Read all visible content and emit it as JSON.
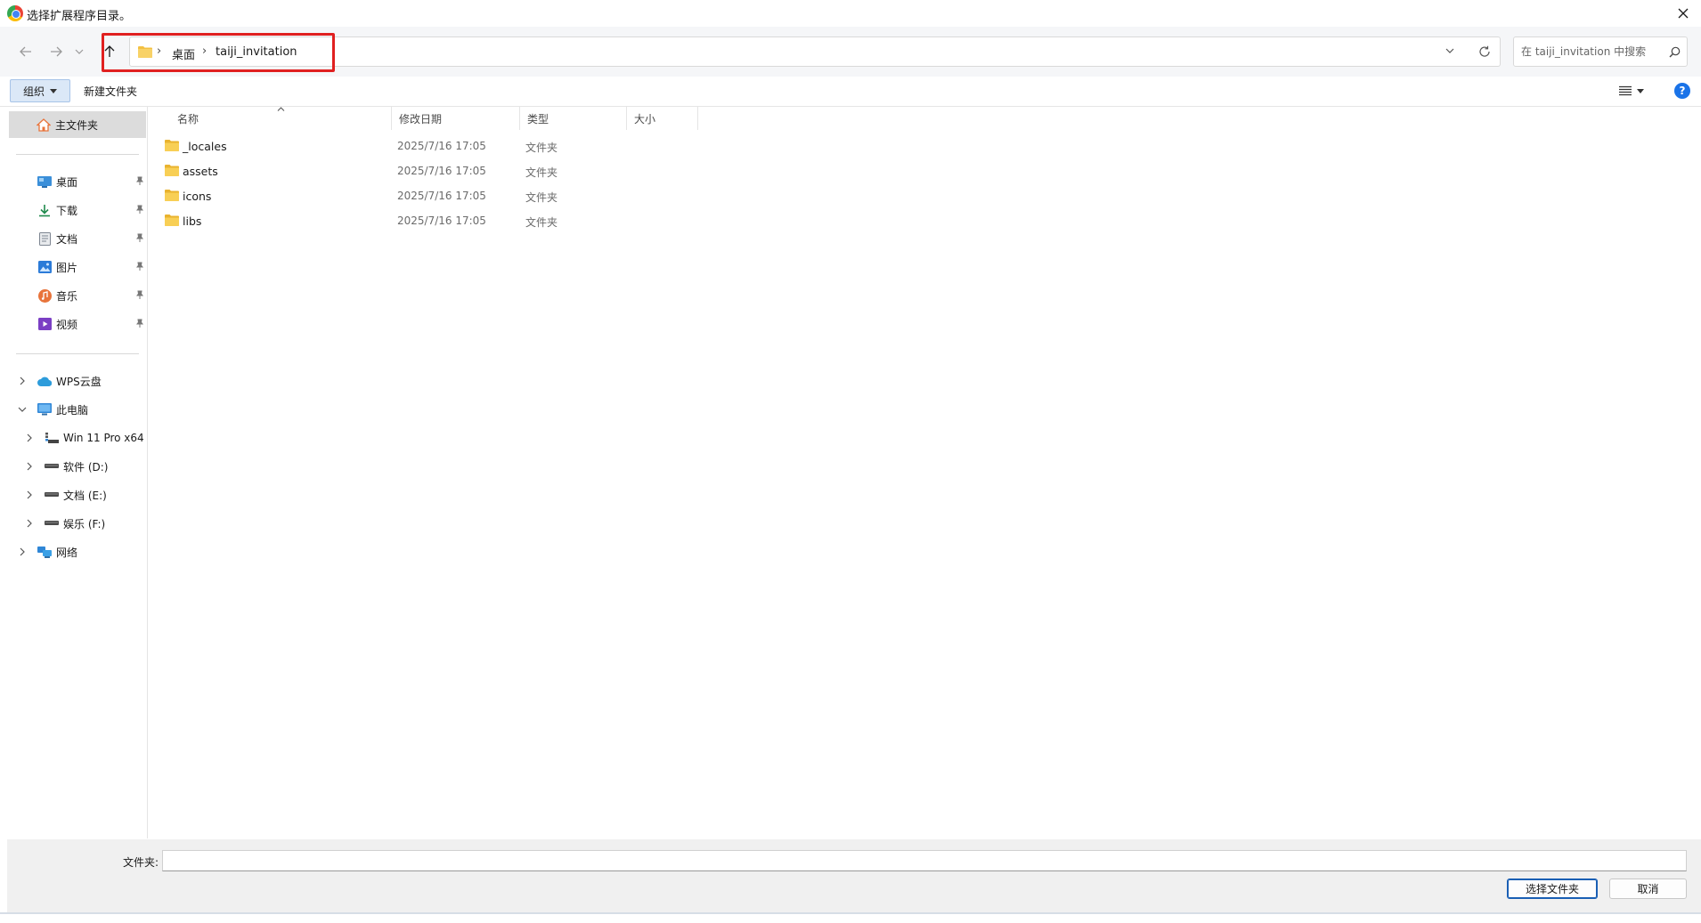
{
  "window": {
    "title": "选择扩展程序目录。"
  },
  "nav": {
    "breadcrumbs": [
      "桌面",
      "taiji_invitation"
    ],
    "search_placeholder": "在 taiji_invitation 中搜索"
  },
  "toolbar": {
    "organize_label": "组织",
    "new_folder_label": "新建文件夹",
    "help_label": "?"
  },
  "sidebar": {
    "home": "主文件夹",
    "quick_access": [
      {
        "label": "桌面",
        "icon": "desktop-icon"
      },
      {
        "label": "下载",
        "icon": "download-icon"
      },
      {
        "label": "文档",
        "icon": "document-icon"
      },
      {
        "label": "图片",
        "icon": "picture-icon"
      },
      {
        "label": "音乐",
        "icon": "music-icon"
      },
      {
        "label": "视频",
        "icon": "video-icon"
      }
    ],
    "wps": "WPS云盘",
    "this_pc": "此电脑",
    "drives": [
      {
        "label": "Win 11 Pro x64",
        "icon": "network-drive-icon"
      },
      {
        "label": "软件 (D:)",
        "icon": "drive-icon"
      },
      {
        "label": "文档 (E:)",
        "icon": "drive-icon"
      },
      {
        "label": "娱乐 (F:)",
        "icon": "drive-icon"
      }
    ],
    "network": "网络"
  },
  "filelist": {
    "columns": [
      "名称",
      "修改日期",
      "类型",
      "大小"
    ],
    "rows": [
      {
        "name": "_locales",
        "date": "2025/7/16 17:05",
        "type": "文件夹"
      },
      {
        "name": "assets",
        "date": "2025/7/16 17:05",
        "type": "文件夹"
      },
      {
        "name": "icons",
        "date": "2025/7/16 17:05",
        "type": "文件夹"
      },
      {
        "name": "libs",
        "date": "2025/7/16 17:05",
        "type": "文件夹"
      }
    ]
  },
  "footer": {
    "folder_label": "文件夹:",
    "folder_value": "",
    "select_button": "选择文件夹",
    "cancel_button": "取消"
  },
  "colors": {
    "highlight": "#e02020",
    "folder": "#f3c042",
    "accent": "#1a5fb4"
  }
}
